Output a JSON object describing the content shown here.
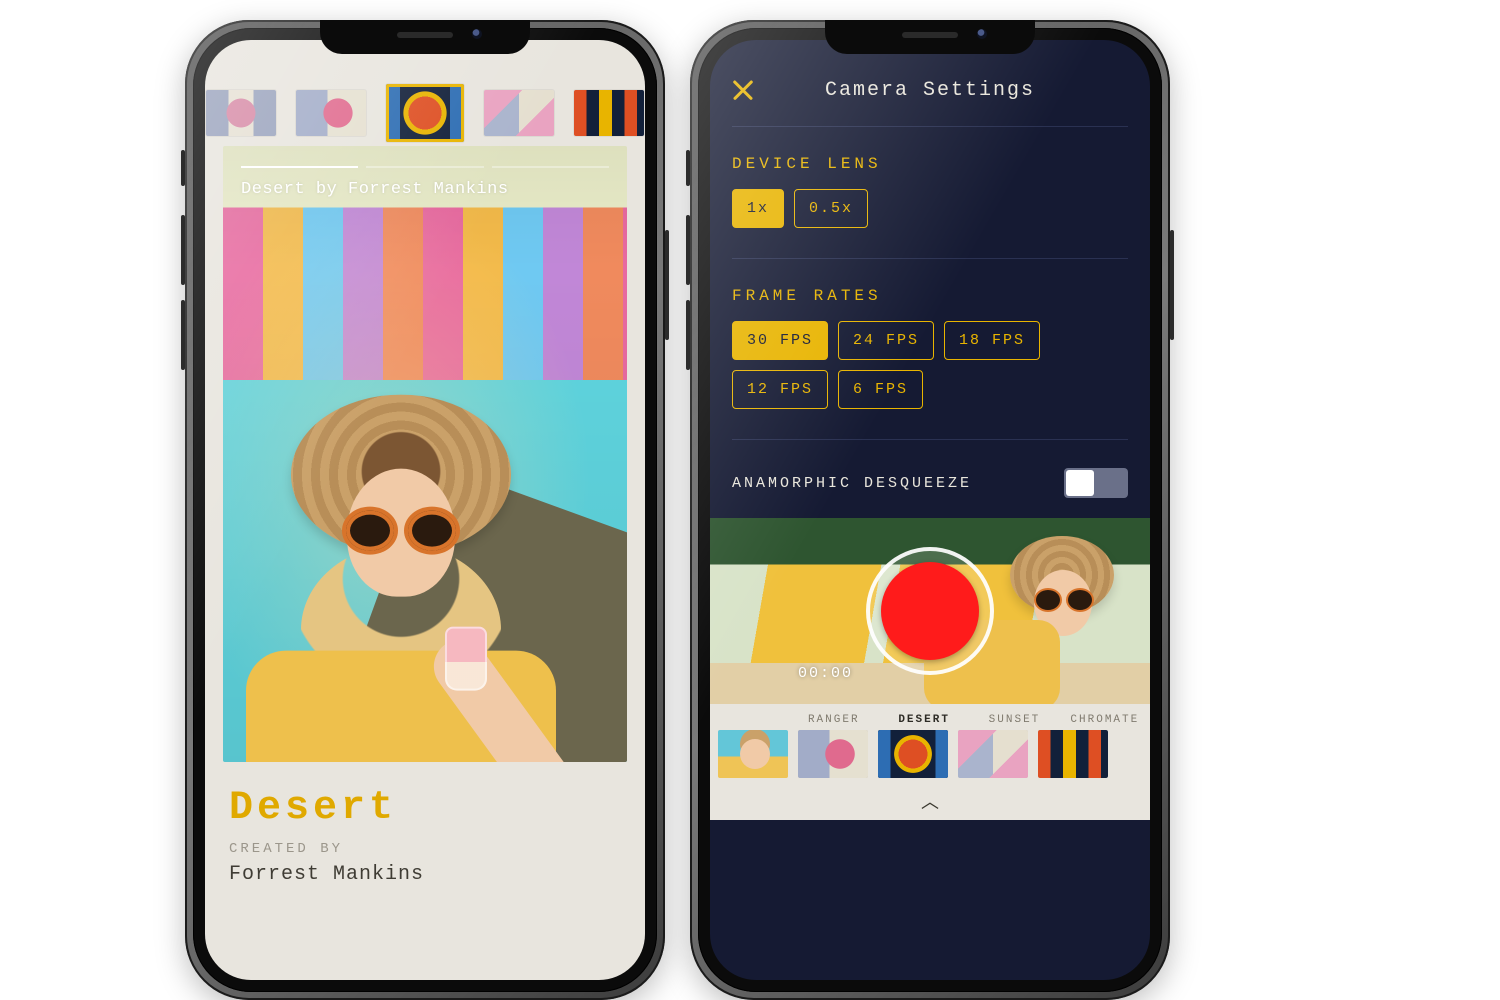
{
  "phoneA": {
    "hero_caption": "Desert by Forrest Mankins",
    "title": "Desert",
    "created_by_label": "CREATED BY",
    "creator": "Forrest Mankins",
    "strip": [
      "a",
      "b",
      "desert",
      "d",
      "e"
    ],
    "strip_selected": "desert"
  },
  "phoneB": {
    "header_title": "Camera Settings",
    "sections": {
      "device_lens": {
        "label": "DEVICE LENS",
        "options": [
          "1x",
          "0.5x"
        ],
        "selected": "1x"
      },
      "frame_rates": {
        "label": "FRAME RATES",
        "options": [
          "30 FPS",
          "24 FPS",
          "18 FPS",
          "12 FPS",
          "6 FPS"
        ],
        "selected": "30 FPS"
      },
      "anamorphic": {
        "label": "ANAMORPHIC DESQUEEZE",
        "on": false
      }
    },
    "viewfinder": {
      "timecode": "00:00"
    },
    "filmstrip": {
      "labels": [
        "RANGER",
        "DESERT",
        "SUNSET",
        "CHROMATE"
      ],
      "selected": "DESERT"
    }
  },
  "colors": {
    "accent": "#e8b400",
    "darkbg": "#151a33",
    "lightbg": "#e8e5de",
    "record": "#ff1b1b"
  }
}
